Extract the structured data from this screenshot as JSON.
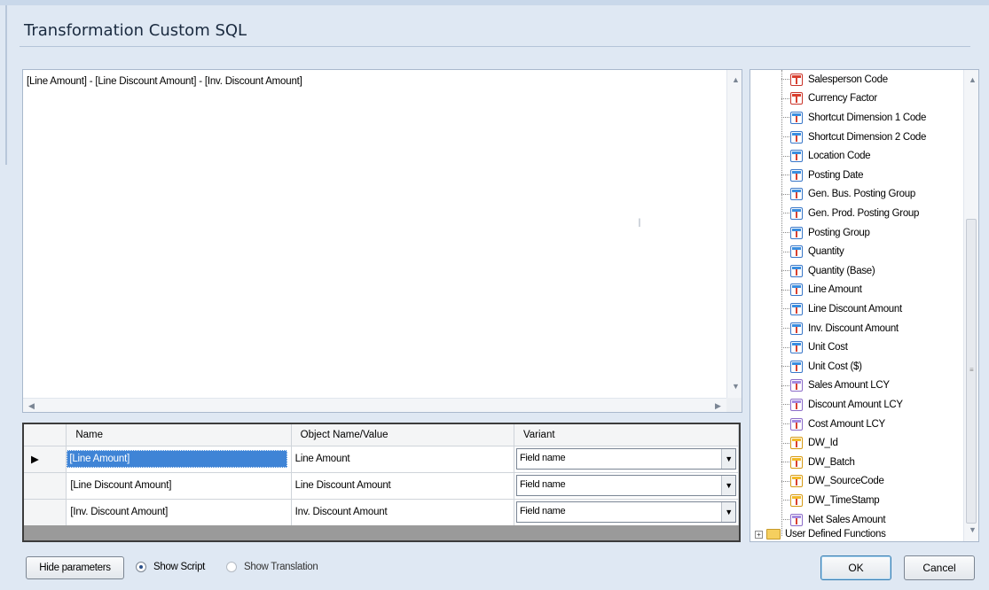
{
  "window": {
    "title": "Transformation Custom SQL"
  },
  "editor": {
    "text": "[Line Amount] - [Line Discount Amount] - [Inv. Discount Amount]"
  },
  "parameters": {
    "columns": [
      "Name",
      "Object Name/Value",
      "Variant"
    ],
    "rows": [
      {
        "name": "[Line Amount]",
        "value": "Line Amount",
        "variant": "Field name"
      },
      {
        "name": "[Line Discount Amount]",
        "value": "Line Discount Amount",
        "variant": "Field name"
      },
      {
        "name": "[Inv. Discount Amount]",
        "value": "Inv. Discount Amount",
        "variant": "Field name"
      }
    ]
  },
  "tree": {
    "items": [
      {
        "label": "Salesperson Code",
        "color": "red"
      },
      {
        "label": "Currency Factor",
        "color": "red"
      },
      {
        "label": "Shortcut Dimension 1 Code",
        "color": "blue"
      },
      {
        "label": "Shortcut Dimension 2 Code",
        "color": "blue"
      },
      {
        "label": "Location Code",
        "color": "blue"
      },
      {
        "label": "Posting Date",
        "color": "blue"
      },
      {
        "label": "Gen. Bus. Posting Group",
        "color": "blue"
      },
      {
        "label": "Gen. Prod. Posting Group",
        "color": "blue"
      },
      {
        "label": "Posting Group",
        "color": "blue"
      },
      {
        "label": "Quantity",
        "color": "blue"
      },
      {
        "label": "Quantity (Base)",
        "color": "blue"
      },
      {
        "label": "Line Amount",
        "color": "blue"
      },
      {
        "label": "Line Discount Amount",
        "color": "blue"
      },
      {
        "label": "Inv. Discount Amount",
        "color": "blue"
      },
      {
        "label": "Unit Cost",
        "color": "blue"
      },
      {
        "label": "Unit Cost ($)",
        "color": "blue"
      },
      {
        "label": "Sales Amount LCY",
        "color": "violet"
      },
      {
        "label": "Discount Amount LCY",
        "color": "violet"
      },
      {
        "label": "Cost Amount LCY",
        "color": "violet"
      },
      {
        "label": "DW_Id",
        "color": "yellow"
      },
      {
        "label": "DW_Batch",
        "color": "yellow"
      },
      {
        "label": "DW_SourceCode",
        "color": "yellow"
      },
      {
        "label": "DW_TimeStamp",
        "color": "yellow"
      },
      {
        "label": "Net Sales Amount",
        "color": "violet"
      }
    ],
    "folder": "User Defined Functions"
  },
  "footer": {
    "hide_parameters": "Hide parameters",
    "show_script": "Show Script",
    "show_translation": "Show Translation",
    "ok": "OK",
    "cancel": "Cancel"
  }
}
